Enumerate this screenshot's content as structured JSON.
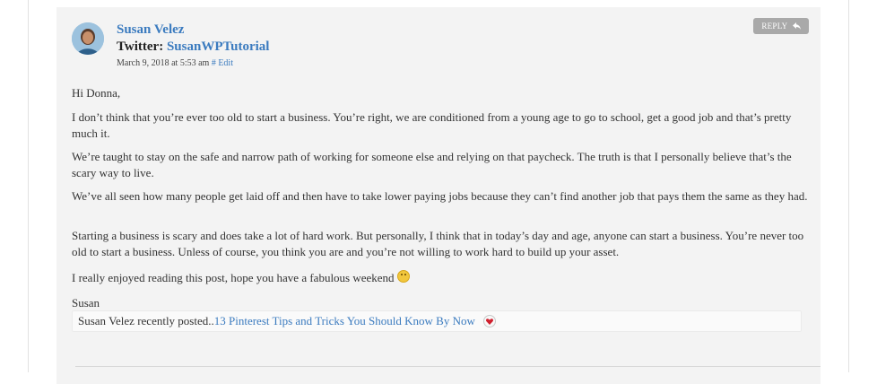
{
  "comment": {
    "author": "Susan Velez",
    "twitter_label": "Twitter:",
    "twitter_handle": "SusanWPTutorial",
    "date": "March 9, 2018 at 5:53 am",
    "edit_label": "# Edit",
    "reply_label": "REPLY",
    "paragraphs": [
      "Hi Donna,",
      "I don’t think that you’re ever too old to start a business. You’re right, we are conditioned from a young age to go to school, get a good job and that’s pretty much it.",
      "We’re taught to stay on the safe and narrow path of working for someone else and relying on that paycheck. The truth is that I personally believe that’s the scary way to live.",
      "We’ve all seen how many people get laid off and then have to take lower paying jobs because they can’t find another job that pays them the same as they had.",
      "Starting a business is scary and does take a lot of hard work. But personally, I think that in today’s day and age, anyone can start a business. You’re never too old to start a business. Unless of course, you think you are and you’re not willing to work hard to build up your asset.",
      "I really enjoyed reading this post, hope you have a fabulous weekend",
      "Susan"
    ],
    "recent_prefix": "Susan Velez recently posted..",
    "recent_link": "13 Pinterest Tips and Tricks You Should Know By Now"
  },
  "icons": {
    "smiley": "smiley-icon",
    "heart": "commentluv-heart-icon",
    "reply": "reply-arrow-icon"
  }
}
